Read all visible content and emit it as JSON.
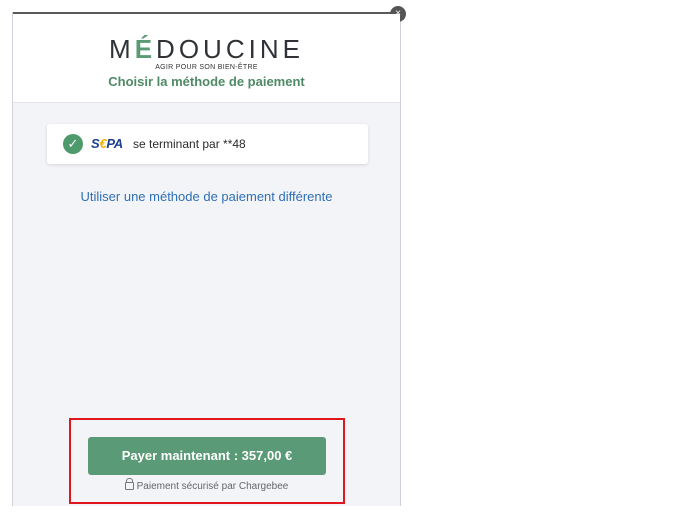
{
  "header": {
    "logo_pre": "M",
    "logo_accent": "É",
    "logo_post": "DOUCINE",
    "tagline": "AGIR POUR SON BIEN-ÊTRE",
    "title": "Choisir la méthode de paiement"
  },
  "payment_method": {
    "brand_s": "S",
    "brand_euro": "€",
    "brand_pa": "PA",
    "text": "se terminant par **48",
    "check_icon": "✓"
  },
  "alt_link": "Utiliser une méthode de paiement différente",
  "pay_button": "Payer maintenant : 357,00 €",
  "secure_text": "Paiement sécurisé par Chargebee",
  "close_icon": "×",
  "colors": {
    "accent_green": "#5b9a76",
    "link_blue": "#2f6fb5",
    "highlight_red": "#e0161b",
    "sepa_blue": "#1e3f8f",
    "sepa_yellow": "#f1b400"
  }
}
